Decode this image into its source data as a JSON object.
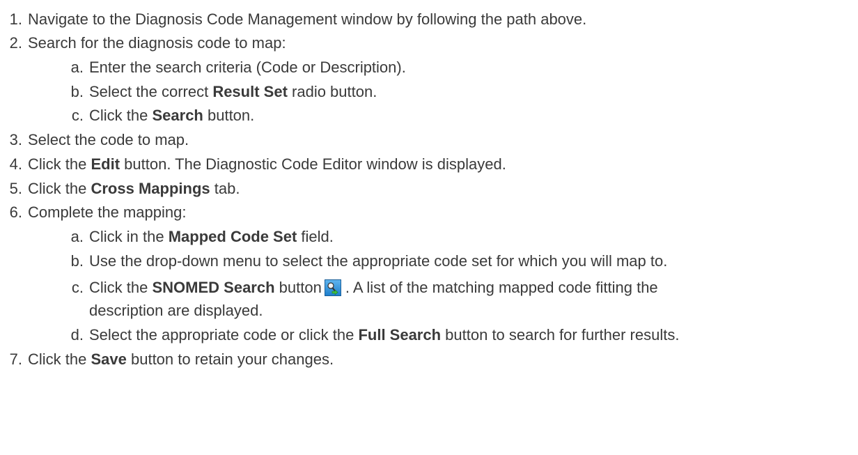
{
  "steps": [
    {
      "num": "1.",
      "text": "Navigate to the Diagnosis Code Management window by following the path above."
    },
    {
      "num": "2.",
      "text": "Search for the diagnosis code to map:"
    },
    {
      "num": "a.",
      "text": "Enter the search criteria (Code or Description)."
    },
    {
      "num": "b.",
      "pre": "Select the correct ",
      "bold": "Result Set",
      "post": " radio button."
    },
    {
      "num": "c.",
      "pre": "Click the ",
      "bold": "Search",
      "post": " button."
    },
    {
      "num": "3.",
      "text": "Select the code to map."
    },
    {
      "num": "4.",
      "pre": "Click the ",
      "bold": "Edit",
      "post": " button. The Diagnostic Code Editor window is displayed."
    },
    {
      "num": "5.",
      "pre": "Click the ",
      "bold": "Cross Mappings",
      "post": " tab."
    },
    {
      "num": "6.",
      "text": "Complete the mapping:"
    },
    {
      "num": "a.",
      "pre": "Click in the ",
      "bold": "Mapped Code Set",
      "post": " field."
    },
    {
      "num": "b.",
      "text": "Use the drop-down menu to select the appropriate code set for which you will map to."
    },
    {
      "num": "c.",
      "pre": "Click the ",
      "bold": "SNOMED Search",
      "post": " button",
      "post2": ". A list of the matching mapped code fitting the",
      "icon": "snomed-search-icon"
    },
    {
      "text": "description are displayed."
    },
    {
      "num": "d.",
      "pre": "Select the appropriate code or click the ",
      "bold": "Full Search",
      "post": " button to search for further results."
    },
    {
      "num": "7.",
      "pre": "Click the ",
      "bold": "Save",
      "post": " button to retain your changes."
    }
  ]
}
